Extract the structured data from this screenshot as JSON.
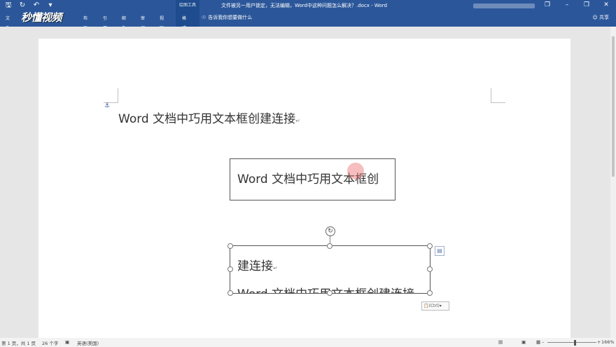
{
  "quick_access": {
    "icons": [
      "save-icon",
      "repeat-icon",
      "undo-icon",
      "customize-icon"
    ]
  },
  "ribbon": {
    "context_group_label": "绘图工具",
    "tabs": [
      "文件",
      "布局",
      "引用",
      "邮件",
      "审阅",
      "视图",
      "格式"
    ],
    "active_tab": "格式",
    "tell_me": "告诉我你想要做什么",
    "share": "共享"
  },
  "window": {
    "title": "文件被另一用户锁定，无法编辑，Word中这种问题怎么解决？.docx - Word"
  },
  "watermark": {
    "logo": "秒懂视频"
  },
  "document": {
    "paragraph1": "Word 文档中巧用文本框创建连接",
    "textbox1": "Word  文档中巧用文本框创",
    "textbox2_line1": "建连接",
    "textbox2_line2": "Word 文档中巧用文本框创建连接"
  },
  "paste_options": {
    "label": "(Ctrl)"
  },
  "status": {
    "page": "第 1 页，共 1 页",
    "words": "26 个字",
    "language": "英语(美国)",
    "zoom": "166%"
  },
  "colors": {
    "ribbon": "#2b579a",
    "accent_cursor": "#eb6e6e"
  }
}
